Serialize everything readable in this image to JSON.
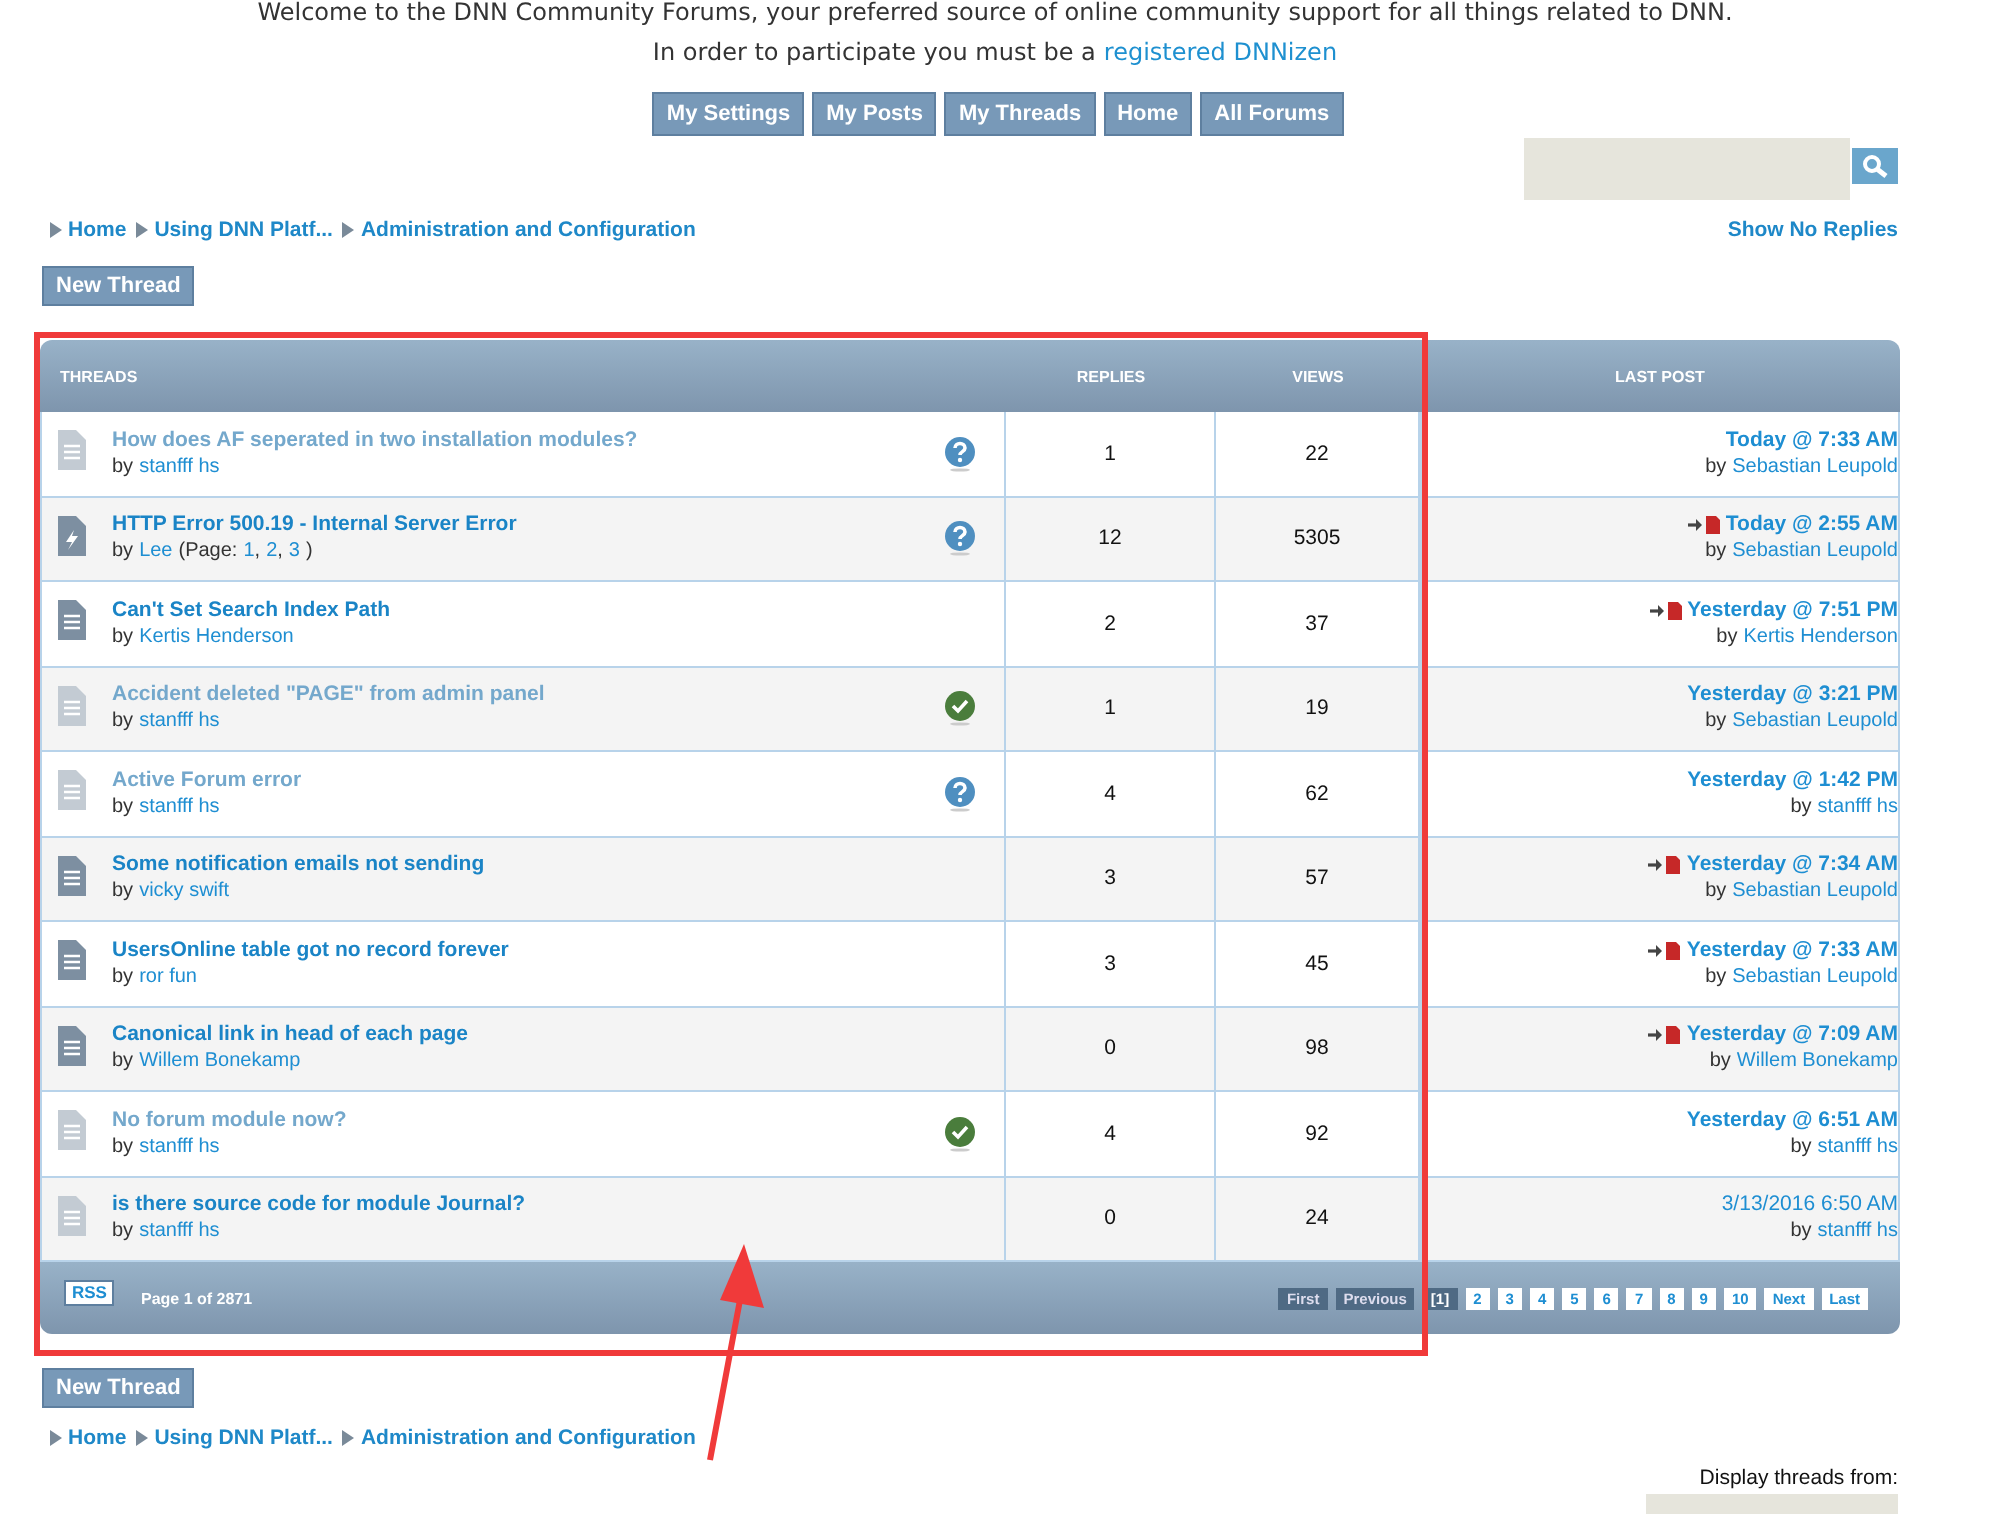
{
  "welcome": {
    "line1": "Welcome to the DNN Community Forums, your preferred source of online community support for all things related to DNN.",
    "line2": "In order to participate you must be a",
    "link": "registered DNNizen"
  },
  "nav_buttons": [
    "My Settings",
    "My Posts",
    "My Threads",
    "Home",
    "All Forums"
  ],
  "breadcrumb": [
    "Home",
    "Using DNN Platf...",
    "Administration and Configuration"
  ],
  "show_no_replies": "Show No Replies",
  "new_thread": "New Thread",
  "table": {
    "columns": [
      "THREADS",
      "REPLIES",
      "VIEWS",
      "LAST POST"
    ],
    "rows": [
      {
        "kind": "read",
        "title": "How does AF seperated in two installation modules?",
        "read": true,
        "by": "by",
        "author": "stanfff hs",
        "badge": {
          "kind": "question"
        },
        "replies": "1",
        "views": "22",
        "jump": false,
        "date": "Today @ 7:33 AM",
        "date_bold": true,
        "last_by_label": "by",
        "last_by": "Sebastian Leupold"
      },
      {
        "kind": "hot",
        "title": "HTTP Error 500.19 - Internal Server Error",
        "read": false,
        "by": "by",
        "author": "Lee",
        "pages_label": "(Page:",
        "pages": [
          {
            "label": "1",
            "sep": ","
          },
          {
            "label": "2",
            "sep": ","
          },
          {
            "label": "3"
          }
        ],
        "pages_end": ")",
        "badge": {
          "kind": "question"
        },
        "replies": "12",
        "views": "5305",
        "jump": true,
        "date": "Today @ 2:55 AM",
        "date_bold": true,
        "last_by_label": "by",
        "last_by": "Sebastian Leupold"
      },
      {
        "kind": "unread",
        "title": "Can't Set Search Index Path",
        "read": false,
        "by": "by",
        "author": "Kertis Henderson",
        "replies": "2",
        "views": "37",
        "jump": true,
        "date": "Yesterday @ 7:51 PM",
        "date_bold": true,
        "last_by_label": "by",
        "last_by": "Kertis Henderson"
      },
      {
        "kind": "read",
        "title": "Accident deleted \"PAGE\" from admin panel",
        "read": true,
        "by": "by",
        "author": "stanfff hs",
        "badge": {
          "kind": "answered"
        },
        "replies": "1",
        "views": "19",
        "jump": false,
        "date": "Yesterday @ 3:21 PM",
        "date_bold": true,
        "last_by_label": "by",
        "last_by": "Sebastian Leupold"
      },
      {
        "kind": "read",
        "title": "Active Forum error",
        "read": true,
        "by": "by",
        "author": "stanfff hs",
        "badge": {
          "kind": "question"
        },
        "replies": "4",
        "views": "62",
        "jump": false,
        "date": "Yesterday @ 1:42 PM",
        "date_bold": true,
        "last_by_label": "by",
        "last_by": "stanfff hs"
      },
      {
        "kind": "unread",
        "title": "Some notification emails not sending",
        "read": false,
        "by": "by",
        "author": "vicky swift",
        "replies": "3",
        "views": "57",
        "jump": true,
        "date": "Yesterday @ 7:34 AM",
        "date_bold": true,
        "last_by_label": "by",
        "last_by": "Sebastian Leupold"
      },
      {
        "kind": "unread",
        "title": "UsersOnline table got no record forever",
        "read": false,
        "by": "by",
        "author": "ror fun",
        "replies": "3",
        "views": "45",
        "jump": true,
        "date": "Yesterday @ 7:33 AM",
        "date_bold": true,
        "last_by_label": "by",
        "last_by": "Sebastian Leupold"
      },
      {
        "kind": "unread",
        "title": "Canonical link in head of each page",
        "read": false,
        "by": "by",
        "author": "Willem Bonekamp",
        "replies": "0",
        "views": "98",
        "jump": true,
        "date": "Yesterday @ 7:09 AM",
        "date_bold": true,
        "last_by_label": "by",
        "last_by": "Willem Bonekamp"
      },
      {
        "kind": "read",
        "title": "No forum module now?",
        "read": true,
        "by": "by",
        "author": "stanfff hs",
        "badge": {
          "kind": "answered"
        },
        "replies": "4",
        "views": "92",
        "jump": false,
        "date": "Yesterday @ 6:51 AM",
        "date_bold": true,
        "last_by_label": "by",
        "last_by": "stanfff hs"
      },
      {
        "kind": "read",
        "title": "is there source code for module Journal?",
        "read": false,
        "by": "by",
        "author": "stanfff hs",
        "replies": "0",
        "views": "24",
        "jump": false,
        "date": "3/13/2016 6:50 AM",
        "date_bold": false,
        "last_by_label": "by",
        "last_by": "stanfff hs"
      }
    ]
  },
  "footer": {
    "rss": "RSS",
    "page_info": "Page 1 of 2871",
    "pager": [
      {
        "label": "First",
        "selected": false,
        "disabled": true
      },
      {
        "label": "Previous",
        "selected": false,
        "disabled": true
      },
      {
        "label": "[1]",
        "selected": true,
        "disabled": false
      },
      {
        "label": "2",
        "selected": false,
        "disabled": false
      },
      {
        "label": "3",
        "selected": false,
        "disabled": false
      },
      {
        "label": "4",
        "selected": false,
        "disabled": false
      },
      {
        "label": "5",
        "selected": false,
        "disabled": false
      },
      {
        "label": "6",
        "selected": false,
        "disabled": false
      },
      {
        "label": "7",
        "selected": false,
        "disabled": false
      },
      {
        "label": "8",
        "selected": false,
        "disabled": false
      },
      {
        "label": "9",
        "selected": false,
        "disabled": false
      },
      {
        "label": "10",
        "selected": false,
        "disabled": false
      },
      {
        "label": "Next",
        "selected": false,
        "disabled": false
      },
      {
        "label": "Last",
        "selected": false,
        "disabled": false
      }
    ]
  },
  "new_thread_bottom": "New Thread",
  "breadcrumb_bottom": [
    "Home",
    "Using DNN Platf...",
    "Administration and Configuration"
  ],
  "display_from": "Display threads from:"
}
